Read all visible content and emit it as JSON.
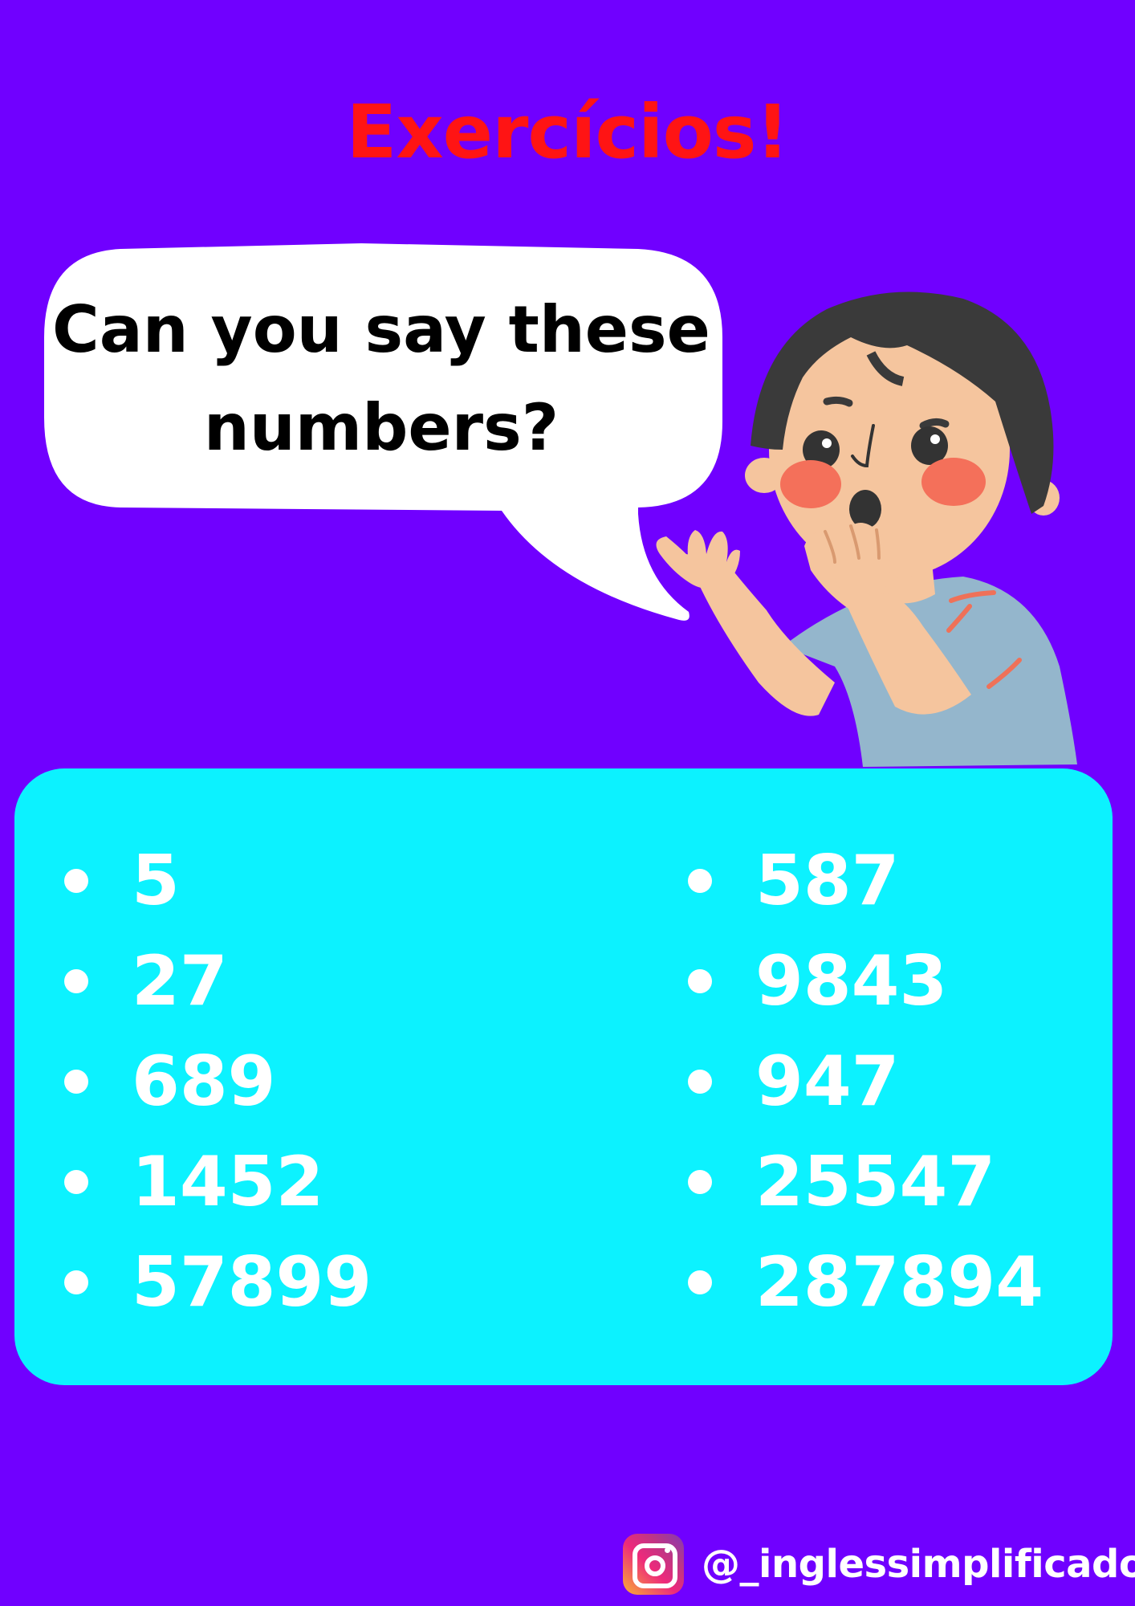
{
  "title": "Exercícios!",
  "bubble_text": "Can you say these numbers?",
  "numbers_left": [
    "5",
    "27",
    "689",
    "1452",
    "57899"
  ],
  "numbers_right": [
    "587",
    "9843",
    "947",
    "25547",
    "287894"
  ],
  "social": {
    "icon": "instagram-icon",
    "handle": "@_inglessimplificado"
  },
  "colors": {
    "background": "#7000ff",
    "title": "#ff1414",
    "panel": "#0cf2ff",
    "number_text": "#ffffff"
  }
}
